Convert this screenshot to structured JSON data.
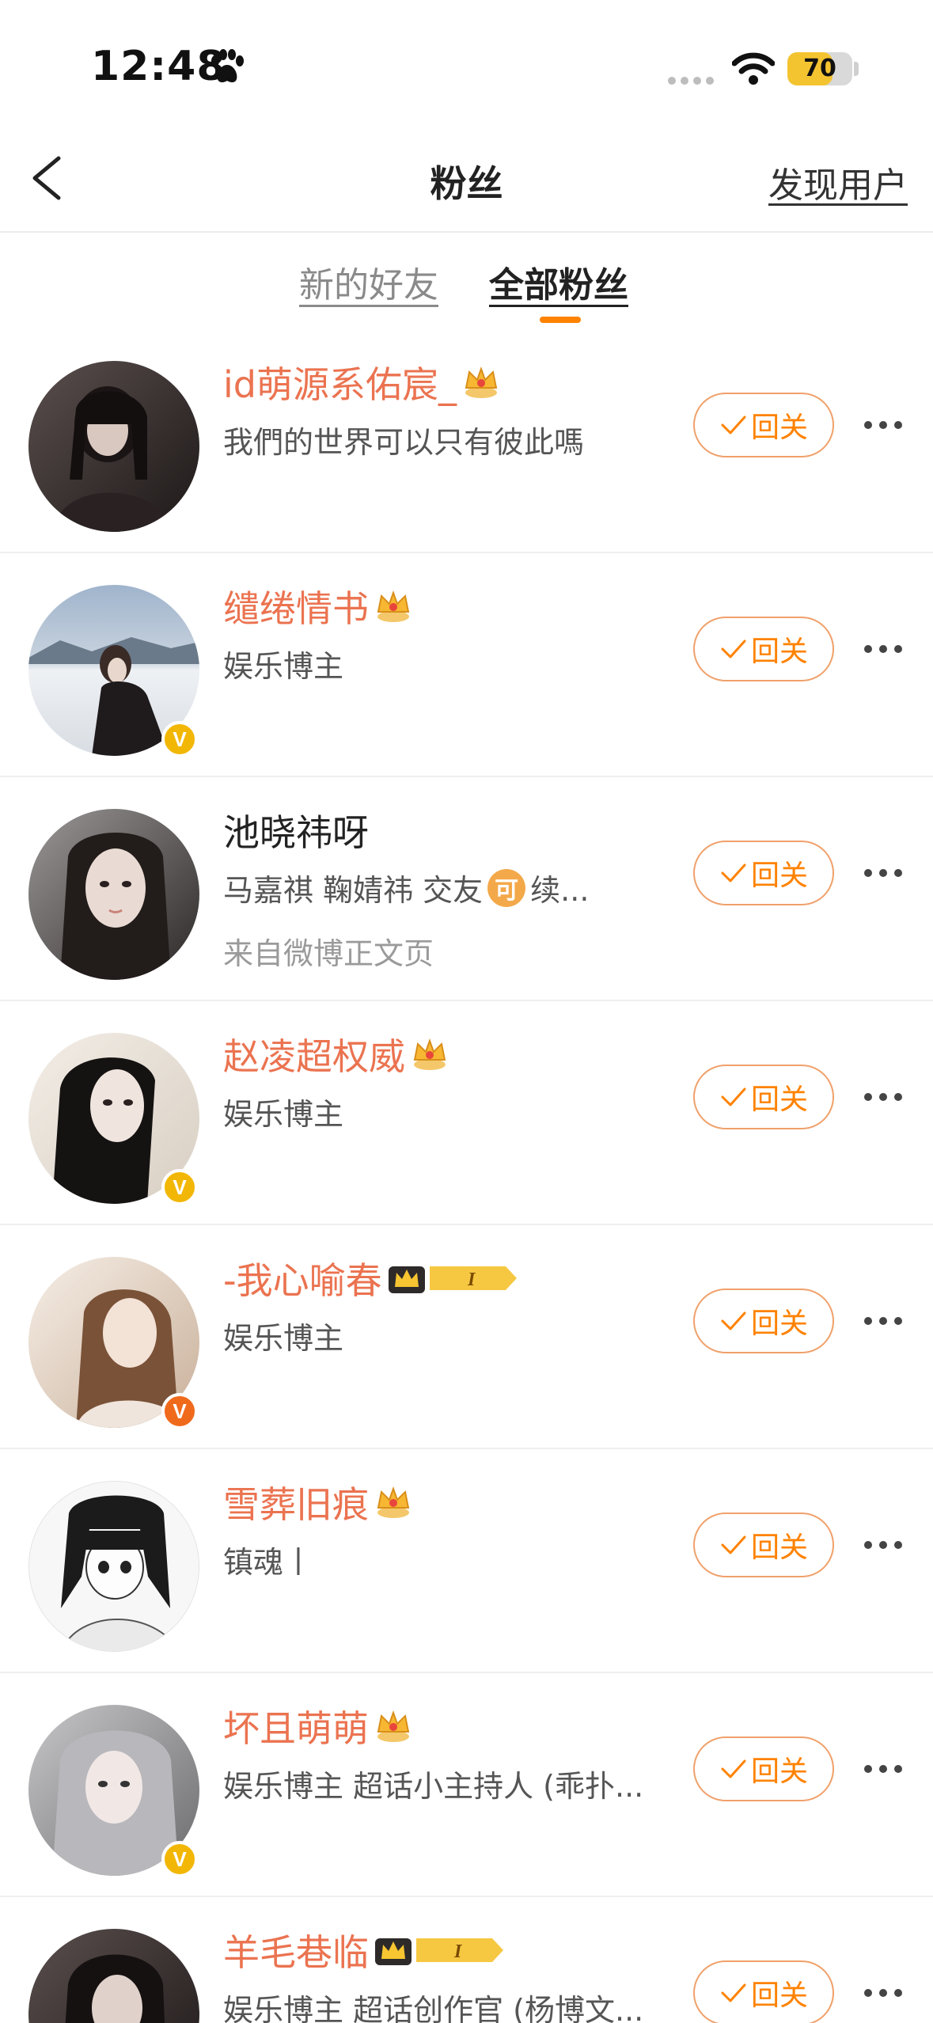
{
  "status_bar": {
    "time": "12:48",
    "battery_level": "70",
    "battery_fraction": 0.7
  },
  "nav": {
    "title": "粉丝",
    "discover_label": "发现用户"
  },
  "tabs": [
    {
      "label": "新的好友",
      "active": false
    },
    {
      "label": "全部粉丝",
      "active": true
    }
  ],
  "follow_label": "回关",
  "fans": [
    {
      "name": "id萌源系佑宸_",
      "desc": "我們的世界可以只有彼此嗎",
      "name_color": "orange",
      "crown": true,
      "level": "",
      "badge": ""
    },
    {
      "name": "缱绻情书",
      "desc": "娱乐博主",
      "name_color": "orange",
      "crown": true,
      "level": "",
      "badge": "gold"
    },
    {
      "name": "池晓祎呀",
      "desc_parts": [
        "马嘉祺  鞠婧祎   交友 ",
        "可",
        "续..."
      ],
      "source": "来自微博正文页",
      "name_color": "black",
      "crown": false,
      "level": "",
      "badge": ""
    },
    {
      "name": "赵凌超权威",
      "desc": "娱乐博主",
      "name_color": "orange",
      "crown": true,
      "level": "",
      "badge": "gold"
    },
    {
      "name": "-我心喻春",
      "desc": "娱乐博主",
      "name_color": "orange",
      "crown": true,
      "level": "I",
      "badge": "orange"
    },
    {
      "name": "雪葬旧痕",
      "desc": "镇魂丨",
      "name_color": "orange",
      "crown": true,
      "level": "",
      "badge": ""
    },
    {
      "name": "坏且萌萌",
      "desc": "娱乐博主 超话小主持人 (乖扑...",
      "name_color": "orange",
      "crown": true,
      "level": "",
      "badge": "gold"
    },
    {
      "name": "羊毛巷临",
      "desc": "娱乐博主 超话创作官 (杨博文...",
      "name_color": "orange",
      "crown": true,
      "level": "I",
      "badge": ""
    }
  ],
  "colors": {
    "accent": "#ff8200",
    "name_orange": "#eb7350",
    "badge_gold": "#f2b705",
    "badge_orange": "#f06a1b"
  }
}
